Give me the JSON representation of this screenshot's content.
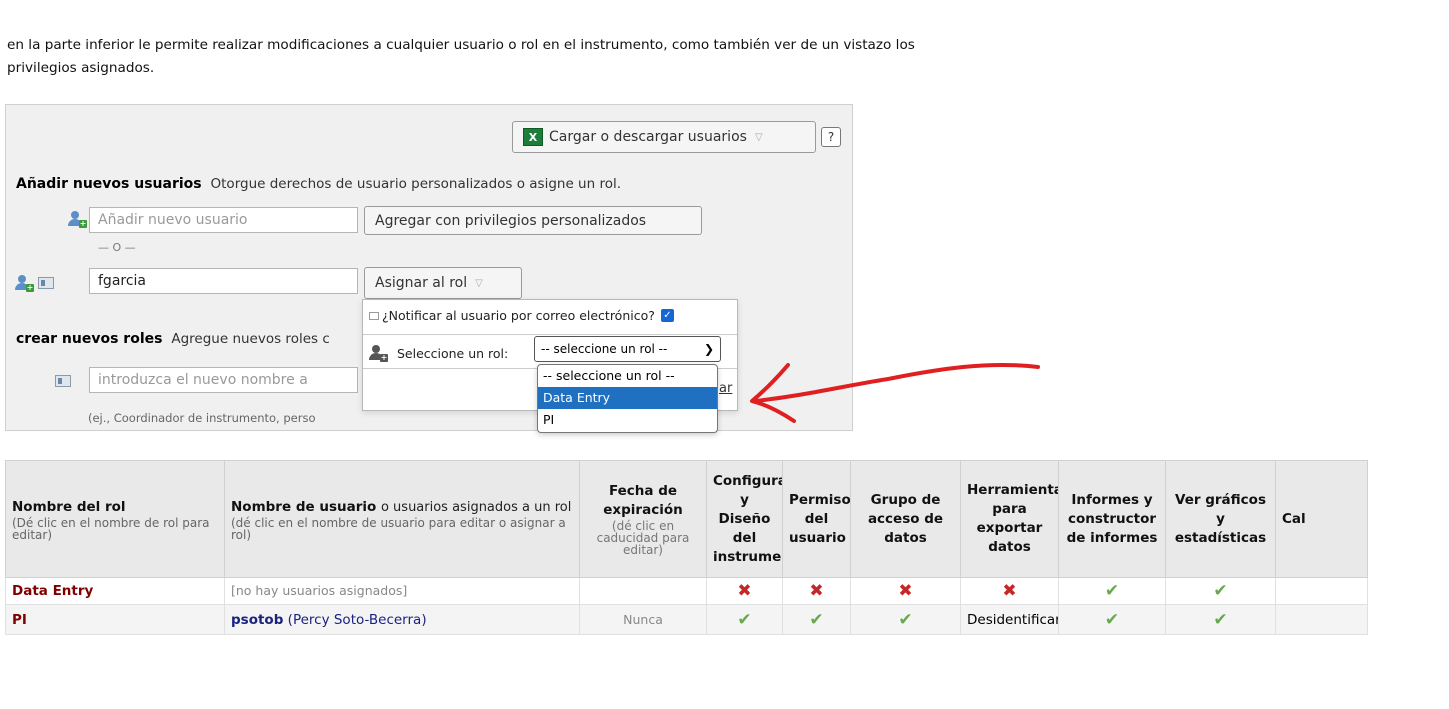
{
  "intro": {
    "line1": "en la parte inferior le permite realizar modificaciones a cualquier usuario o rol en el instrumento, como también ver de un vistazo los",
    "line2": "privilegios asignados."
  },
  "panel": {
    "upload_button": "Cargar o descargar usuarios",
    "help_button": "?",
    "add_users_title": "Añadir nuevos usuarios",
    "add_users_desc": "Otorgue derechos de usuario personalizados o asigne un rol.",
    "new_user_placeholder": "Añadir nuevo usuario",
    "add_custom_button": "Agregar con privilegios personalizados",
    "or_separator": "— O —",
    "username_value": "fgarcia",
    "assign_role_button": "Asignar al rol",
    "create_roles_title": "crear nuevos roles",
    "create_roles_desc": "Agregue nuevos roles c",
    "new_role_placeholder": "introduzca el nuevo nombre a",
    "role_hint": "(ej., Coordinador de instrumento, perso"
  },
  "assign_popover": {
    "notify_label": "¿Notificar al usuario por correo electrónico?",
    "notify_checked": true,
    "select_label": "Seleccione un rol:",
    "select_value": "-- seleccione un rol --",
    "options": [
      "-- seleccione un rol --",
      "Data Entry",
      "PI"
    ],
    "highlighted_option": "Data Entry",
    "peek_text": "ar"
  },
  "roles_table": {
    "headers": {
      "role_name": "Nombre del rol",
      "role_name_sub": "(Dé clic en el nombre de rol para editar)",
      "usernames": "Nombre de usuario",
      "usernames_rest": "o usuarios asignados a un rol",
      "usernames_sub": "(dé clic en el nombre de usuario para editar o asignar a rol)",
      "expiration": "Fecha de expiración",
      "expiration_sub": "(dé clic en caducidad para editar)",
      "config": "Configurac y Diseño del instrument",
      "permissions": "Permiso del usuario",
      "dag": "Grupo de acceso de datos",
      "export": "Herramienta para exportar datos",
      "reports": "Informes y constructor de informes",
      "graphs": "Ver gráficos y estadísticas",
      "next": "Cal"
    },
    "rows": [
      {
        "role": "Data Entry",
        "users_note": "[no hay usuarios asignados]",
        "expiration": "",
        "config": "no",
        "permissions": "no",
        "dag": "no",
        "export": "no",
        "reports": "yes",
        "graphs": "yes"
      },
      {
        "role": "PI",
        "username": "psotob",
        "fullname": "(Percy Soto-Becerra)",
        "expiration": "Nunca",
        "config": "yes",
        "permissions": "yes",
        "dag": "yes",
        "export": "Desidentificar",
        "reports": "yes",
        "graphs": "yes"
      }
    ]
  },
  "colors": {
    "role_link": "#800000",
    "user_link": "#1a237e",
    "cross": "#c62828",
    "check": "#6aa84f",
    "annotation_arrow": "#e02020",
    "option_highlight": "#1f70c1"
  }
}
